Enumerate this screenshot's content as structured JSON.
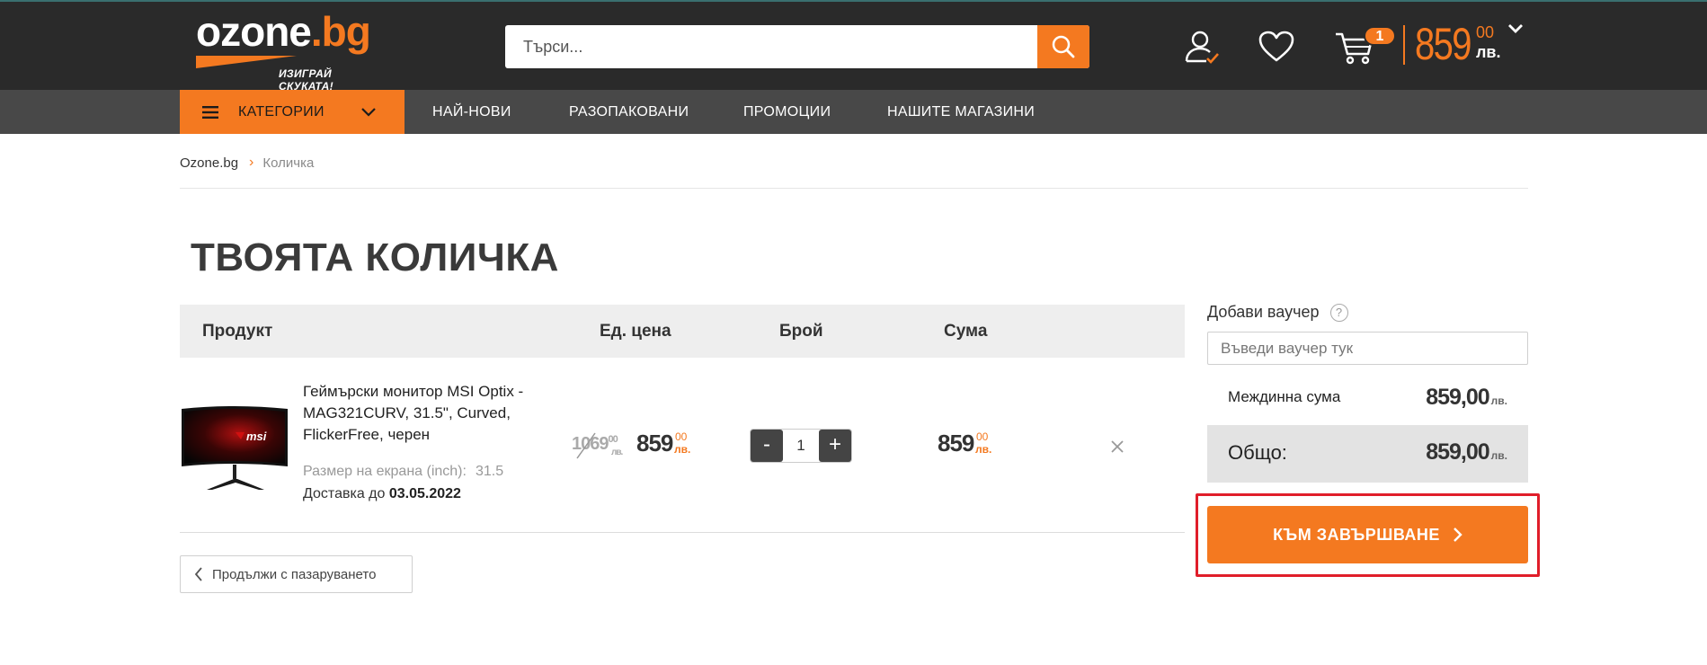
{
  "header": {
    "logo": {
      "main": "ozone",
      "suffix": ".bg",
      "tagline": "ИЗИГРАЙ СКУКАТА!"
    },
    "search": {
      "placeholder": "Търси..."
    },
    "cart": {
      "count": "1",
      "total_int": "859",
      "total_cents": "00",
      "currency": "лв."
    },
    "icons": [
      "user-icon",
      "heart-icon",
      "cart-icon",
      "chevron-down-icon",
      "search-icon"
    ]
  },
  "nav": {
    "categories_label": "КАТЕГОРИИ",
    "items": [
      "НАЙ-НОВИ",
      "РАЗОПАКОВАНИ",
      "ПРОМОЦИИ",
      "НАШИТЕ МАГАЗИНИ"
    ]
  },
  "breadcrumb": {
    "home": "Ozone.bg",
    "current": "Количка"
  },
  "page": {
    "title": "ТВОЯТА КОЛИЧКА"
  },
  "table": {
    "headers": [
      "Продукт",
      "Ед. цена",
      "Брой",
      "Сума"
    ],
    "rows": [
      {
        "name": "Геймърски монитор MSI Optix - MAG321CURV, 31.5\", Curved, FlickerFree, черен",
        "attr_label": "Размер на екрана (inch):",
        "attr_value": "31.5",
        "delivery_prefix": "Доставка до",
        "delivery_date": "03.05.2022",
        "old_price_int": "1069",
        "old_price_cents": "00",
        "old_price_currency": "лв.",
        "price_int": "859",
        "price_cents": "00",
        "price_currency": "лв.",
        "qty": "1",
        "sum_int": "859",
        "sum_cents": "00",
        "sum_currency": "лв."
      }
    ]
  },
  "continue_label": "Продължи с пазаруването",
  "summary": {
    "voucher_label": "Добави ваучер",
    "voucher_help": "?",
    "voucher_placeholder": "Въведи ваучер тук",
    "subtotal_label": "Междинна сума",
    "subtotal_value": "859,00",
    "total_label": "Общо:",
    "total_value": "859,00",
    "currency": "лв.",
    "checkout_label": "КЪМ ЗАВЪРШВАНЕ"
  },
  "colors": {
    "accent": "#f47920",
    "header_bg": "#2a2a2a",
    "nav_bg": "#484848",
    "highlight": "#e01e2a"
  }
}
